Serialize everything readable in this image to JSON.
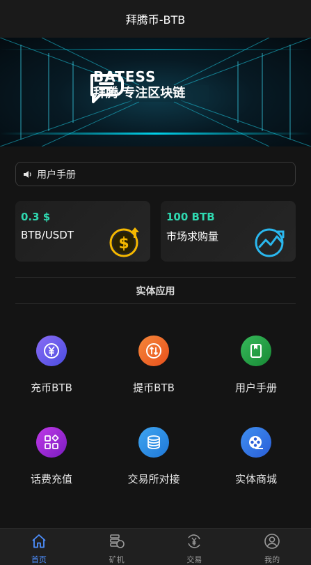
{
  "header": {
    "title": "拜腾币-BTB"
  },
  "banner": {
    "brand_name": "BATESS",
    "slogan": "拜腾 专注区块链"
  },
  "notice": {
    "icon": "speaker-icon",
    "text": "用户手册"
  },
  "cards": [
    {
      "value": "0.3 $",
      "label": "BTB/USDT",
      "icon": "dollar-coin-icon"
    },
    {
      "value": "100 BTB",
      "label": "市场求购量",
      "icon": "trend-chart-icon"
    }
  ],
  "section": {
    "title": "实体应用"
  },
  "grid": [
    {
      "label": "充币BTB",
      "icon": "yuan-coin-icon",
      "color": "#6b5cf0"
    },
    {
      "label": "提币BTB",
      "icon": "transfer-icon",
      "color": "#f06a2a"
    },
    {
      "label": "用户手册",
      "icon": "book-icon",
      "color": "#23a047"
    },
    {
      "label": "话费充值",
      "icon": "apps-icon",
      "color": "#a22bd8"
    },
    {
      "label": "交易所对接",
      "icon": "database-icon",
      "color": "#2f8fe8"
    },
    {
      "label": "实体商城",
      "icon": "film-reel-icon",
      "color": "#2f6fe8"
    }
  ],
  "tabbar": [
    {
      "label": "首页",
      "icon": "home-icon",
      "active": true
    },
    {
      "label": "矿机",
      "icon": "miner-icon",
      "active": false
    },
    {
      "label": "交易",
      "icon": "exchange-icon",
      "active": false
    },
    {
      "label": "我的",
      "icon": "user-icon",
      "active": false
    }
  ],
  "colors": {
    "accent": "#2fd8b0",
    "active_tab": "#4d8fff",
    "background": "#141414"
  }
}
